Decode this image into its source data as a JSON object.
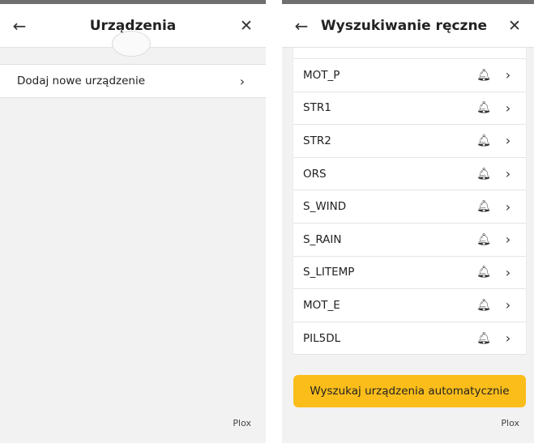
{
  "left": {
    "header": {
      "back_icon": "←",
      "title": "Urządzenia",
      "close_icon": "✕"
    },
    "menu_item": {
      "label": "Dodaj nowe urządzenie",
      "chevron": "›"
    },
    "footer": "Plox"
  },
  "right": {
    "header": {
      "back_icon": "←",
      "title": "Wyszukiwanie ręczne",
      "close_icon": "✕"
    },
    "devices": [
      {
        "name": "MOT_P"
      },
      {
        "name": "STR1"
      },
      {
        "name": "STR2"
      },
      {
        "name": "ORS"
      },
      {
        "name": "S_WIND"
      },
      {
        "name": "S_RAIN"
      },
      {
        "name": "S_LITEMP"
      },
      {
        "name": "MOT_E"
      },
      {
        "name": "PIL5DL"
      }
    ],
    "bell_glyph": "🔔︎",
    "chevron": "›",
    "auto_search_label": "Wyszukaj urządzenia automatycznie",
    "footer": "Plox"
  }
}
